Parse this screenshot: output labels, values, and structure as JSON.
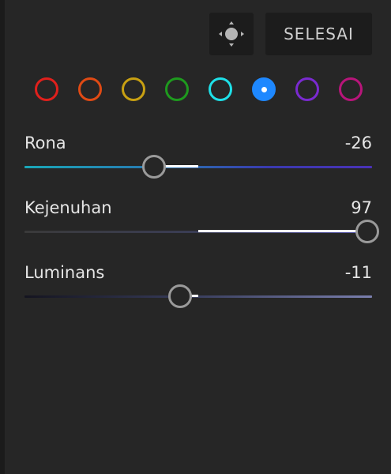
{
  "toolbar": {
    "target_icon": "move-crosshair-icon",
    "done_label": "SELESAI"
  },
  "swatches": [
    {
      "name": "red",
      "color": "#e0201c"
    },
    {
      "name": "orange",
      "color": "#e04a14"
    },
    {
      "name": "yellow",
      "color": "#c8a012"
    },
    {
      "name": "green",
      "color": "#1e9a1e"
    },
    {
      "name": "aqua",
      "color": "#1ee0e8"
    },
    {
      "name": "blue",
      "color": "#1e88ff",
      "selected": true
    },
    {
      "name": "purple",
      "color": "#7a2ad0"
    },
    {
      "name": "magenta",
      "color": "#b8157a"
    }
  ],
  "sliders": {
    "hue": {
      "label": "Rona",
      "value": "-26",
      "min": -100,
      "max": 100,
      "num": -26
    },
    "saturation": {
      "label": "Kejenuhan",
      "value": "97",
      "min": -100,
      "max": 100,
      "num": 97
    },
    "luminance": {
      "label": "Luminans",
      "value": "-11",
      "min": -100,
      "max": 100,
      "num": -11
    }
  }
}
